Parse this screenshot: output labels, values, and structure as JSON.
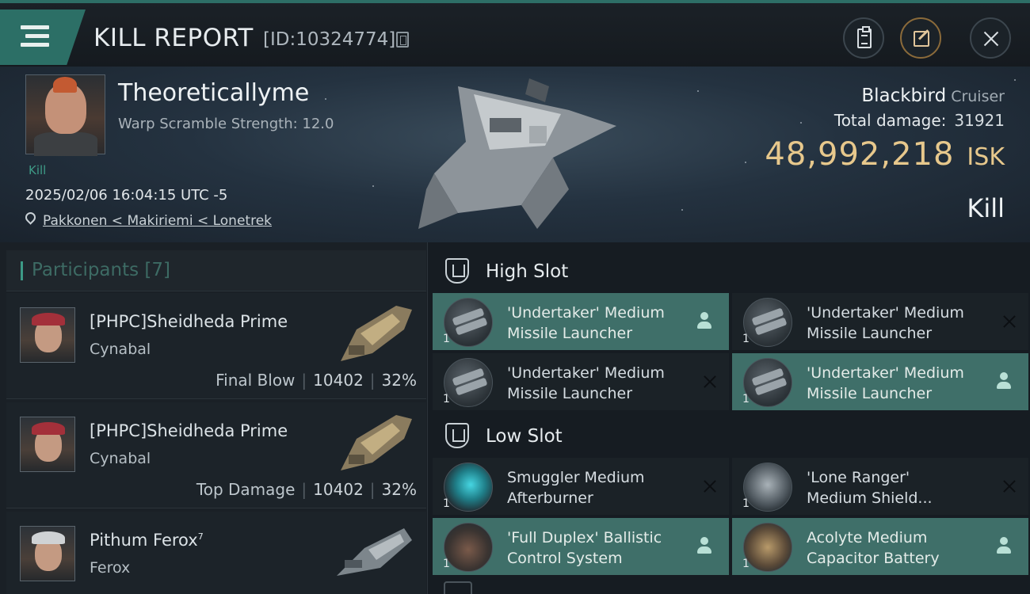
{
  "header": {
    "title": "KILL REPORT",
    "report_id": "[ID:10324774]"
  },
  "victim": {
    "name": "Theoreticallyme",
    "warp_scramble": "Warp Scramble Strength: 12.0",
    "kill_tag": "Kill",
    "timestamp": "2025/02/06 16:04:15 UTC -5",
    "location": "Pakkonen < Makiriemi < Lonetrek",
    "ship": "Blackbird",
    "ship_class": "Cruiser",
    "total_damage_label": "Total damage:",
    "total_damage": "31921",
    "isk_value": "48,992,218",
    "isk_unit": "ISK",
    "result": "Kill"
  },
  "participants": {
    "title": "Participants [7]",
    "rows": [
      {
        "name": "[PHPC]Sheidheda Prime",
        "ship": "Cynabal",
        "role": "Final Blow",
        "damage": "10402",
        "percent": "32%"
      },
      {
        "name": "[PHPC]Sheidheda Prime",
        "ship": "Cynabal",
        "role": "Top Damage",
        "damage": "10402",
        "percent": "32%"
      },
      {
        "name": "Pithum Ferox",
        "name_sup": "7",
        "ship": "Ferox"
      }
    ]
  },
  "slots": {
    "high": {
      "label": "High Slot",
      "modules": [
        {
          "name_line1": "'Undertaker' Medium",
          "name_line2": "Missile Launcher",
          "qty": "1",
          "status": "fitted"
        },
        {
          "name_line1": "'Undertaker' Medium",
          "name_line2": "Missile Launcher",
          "qty": "1",
          "status": "destroyed"
        },
        {
          "name_line1": "'Undertaker' Medium",
          "name_line2": "Missile Launcher",
          "qty": "1",
          "status": "destroyed"
        },
        {
          "name_line1": "'Undertaker' Medium",
          "name_line2": "Missile Launcher",
          "qty": "1",
          "status": "fitted"
        }
      ]
    },
    "low": {
      "label": "Low Slot",
      "modules": [
        {
          "name_line1": "Smuggler Medium",
          "name_line2": "Afterburner",
          "qty": "1",
          "status": "destroyed"
        },
        {
          "name_line1": "'Lone Ranger'",
          "name_line2": "Medium Shield...",
          "qty": "1",
          "status": "destroyed"
        },
        {
          "name_line1": "'Full Duplex' Ballistic",
          "name_line2": "Control System",
          "qty": "1",
          "status": "fitted"
        },
        {
          "name_line1": "Acolyte Medium",
          "name_line2": "Capacitor Battery",
          "qty": "1",
          "status": "fitted"
        }
      ]
    }
  },
  "colors": {
    "accent": "#2c6f66",
    "fitted_bg": "#3f6f69",
    "isk": "#e7c88c"
  }
}
